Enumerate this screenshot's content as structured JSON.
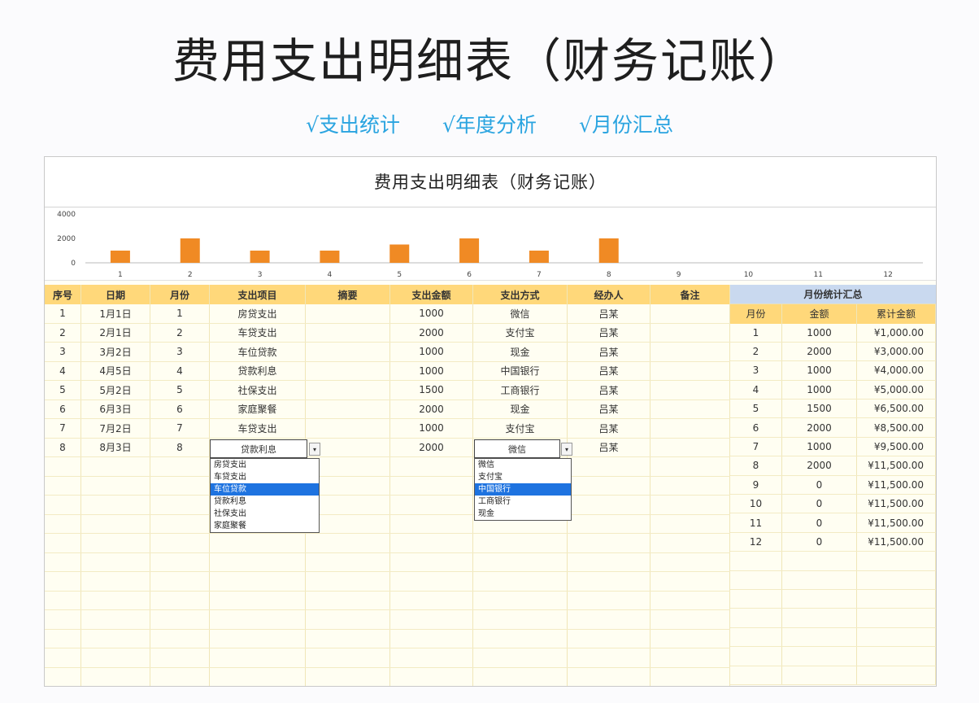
{
  "header": {
    "title": "费用支出明细表（财务记账）",
    "features": [
      "√支出统计",
      "√年度分析",
      "√月份汇总"
    ]
  },
  "sheet": {
    "title": "费用支出明细表（财务记账）"
  },
  "chart_data": {
    "type": "bar",
    "categories": [
      "1",
      "2",
      "3",
      "4",
      "5",
      "6",
      "7",
      "8",
      "9",
      "10",
      "11",
      "12"
    ],
    "values": [
      1000,
      2000,
      1000,
      1000,
      1500,
      2000,
      1000,
      2000,
      0,
      0,
      0,
      0
    ],
    "ylim": [
      0,
      4000
    ],
    "yticks": [
      "4000",
      "2000",
      "0"
    ],
    "color": "#f08a24",
    "grid": false,
    "legend": "none"
  },
  "ledger": {
    "columns": [
      "序号",
      "日期",
      "月份",
      "支出项目",
      "摘要",
      "支出金额",
      "支出方式",
      "经办人",
      "备注"
    ],
    "rows": [
      [
        "1",
        "1月1日",
        "1",
        "房贷支出",
        "",
        "1000",
        "微信",
        "吕某",
        ""
      ],
      [
        "2",
        "2月1日",
        "2",
        "车贷支出",
        "",
        "2000",
        "支付宝",
        "吕某",
        ""
      ],
      [
        "3",
        "3月2日",
        "3",
        "车位贷款",
        "",
        "1000",
        "现金",
        "吕某",
        ""
      ],
      [
        "4",
        "4月5日",
        "4",
        "贷款利息",
        "",
        "1000",
        "中国银行",
        "吕某",
        ""
      ],
      [
        "5",
        "5月2日",
        "5",
        "社保支出",
        "",
        "1500",
        "工商银行",
        "吕某",
        ""
      ],
      [
        "6",
        "6月3日",
        "6",
        "家庭聚餐",
        "",
        "2000",
        "现金",
        "吕某",
        ""
      ],
      [
        "7",
        "7月2日",
        "7",
        "车贷支出",
        "",
        "1000",
        "支付宝",
        "吕某",
        ""
      ],
      [
        "8",
        "8月3日",
        "8",
        "贷款利息",
        "",
        "2000",
        "微信",
        "吕某",
        ""
      ]
    ],
    "empty_rows": 12
  },
  "dropdown_item": {
    "current": "贷款利息",
    "options": [
      "房贷支出",
      "车贷支出",
      "车位贷款",
      "贷款利息",
      "社保支出",
      "家庭聚餐"
    ],
    "selected_index": 2
  },
  "dropdown_method": {
    "current": "微信",
    "options": [
      "微信",
      "支付宝",
      "中国银行",
      "工商银行",
      "现金"
    ],
    "selected_index": 2
  },
  "summary": {
    "title": "月份统计汇总",
    "columns": [
      "月份",
      "金额",
      "累计金额"
    ],
    "rows": [
      [
        "1",
        "1000",
        "¥1,000.00"
      ],
      [
        "2",
        "2000",
        "¥3,000.00"
      ],
      [
        "3",
        "1000",
        "¥4,000.00"
      ],
      [
        "4",
        "1000",
        "¥5,000.00"
      ],
      [
        "5",
        "1500",
        "¥6,500.00"
      ],
      [
        "6",
        "2000",
        "¥8,500.00"
      ],
      [
        "7",
        "1000",
        "¥9,500.00"
      ],
      [
        "8",
        "2000",
        "¥11,500.00"
      ],
      [
        "9",
        "0",
        "¥11,500.00"
      ],
      [
        "10",
        "0",
        "¥11,500.00"
      ],
      [
        "11",
        "0",
        "¥11,500.00"
      ],
      [
        "12",
        "0",
        "¥11,500.00"
      ]
    ],
    "empty_rows": 7
  }
}
